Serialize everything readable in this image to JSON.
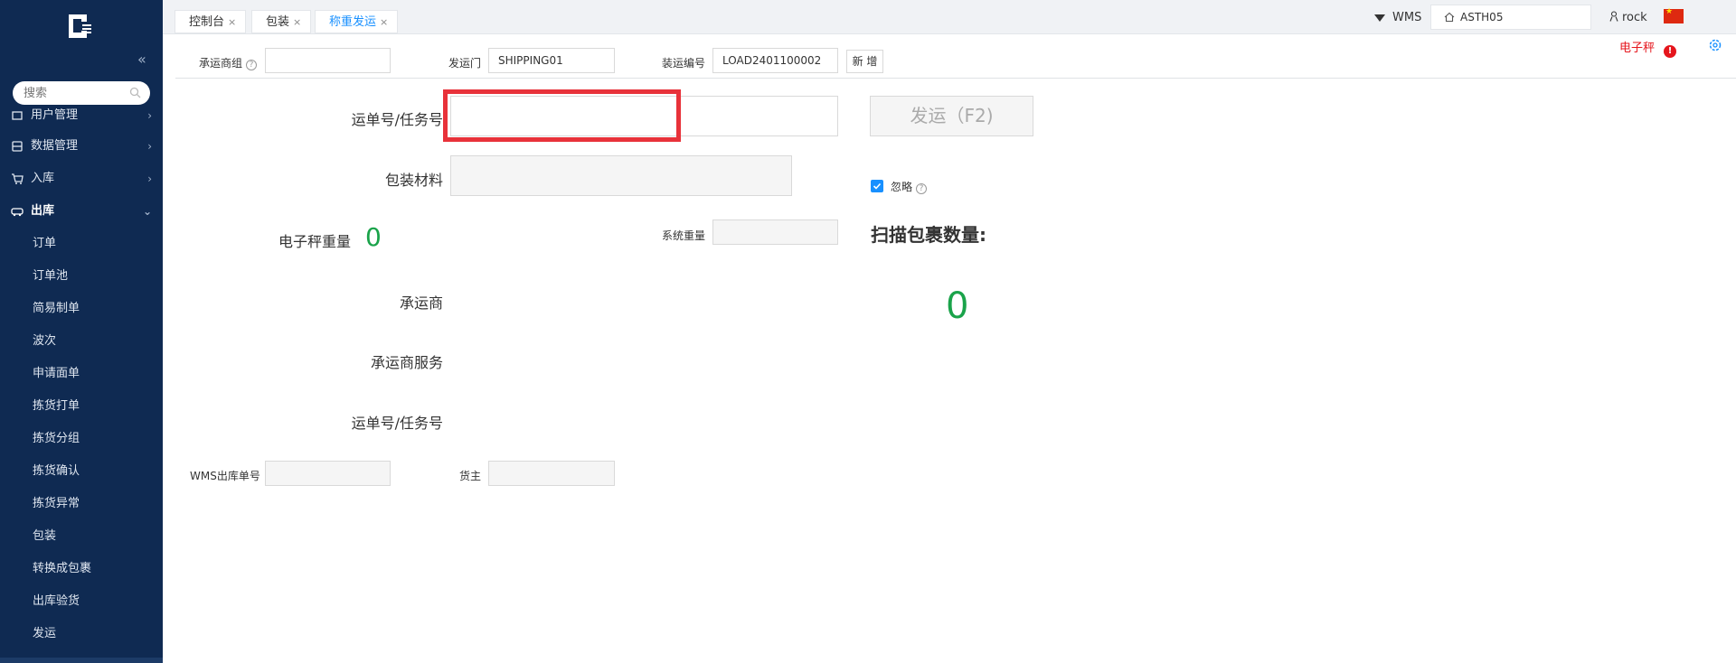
{
  "sidebar": {
    "search_placeholder": "搜索",
    "menu": [
      {
        "label": "用户管理",
        "icon": "user-icon"
      },
      {
        "label": "数据管理",
        "icon": "database-icon"
      },
      {
        "label": "入库",
        "icon": "cart-icon"
      },
      {
        "label": "出库",
        "icon": "truck-icon"
      }
    ],
    "submenu": [
      "订单",
      "订单池",
      "简易制单",
      "波次",
      "申请面单",
      "拣货打单",
      "拣货分组",
      "拣货确认",
      "拣货异常",
      "包装",
      "转换成包裹",
      "出库验货",
      "发运"
    ]
  },
  "tabs": [
    {
      "label": "控制台",
      "close": "×"
    },
    {
      "label": "包装",
      "close": "×"
    },
    {
      "label": "称重发运",
      "close": "×"
    }
  ],
  "header": {
    "system": "WMS",
    "warehouse": "ASTH05",
    "user": "rock",
    "scale_label": "电子秤",
    "scale_error": "!"
  },
  "filters": {
    "carrier_group_label": "承运商组",
    "carrier_group_value": "",
    "dock_label": "发运门",
    "dock_value": "SHIPPING01",
    "load_label": "装运编号",
    "load_value": "LOAD2401100002",
    "add_button": "新 增"
  },
  "form": {
    "waybill_label": "运单号/任务号",
    "waybill_value": "",
    "ship_button": "发运（F2)",
    "packing_label": "包装材料",
    "ignore_label": "忽略",
    "scale_weight_label": "电子秤重量",
    "scale_weight_value": "0",
    "system_weight_label": "系统重量",
    "scan_count_label": "扫描包裹数量:",
    "scan_count_value": "0",
    "carrier_label": "承运商",
    "carrier_service_label": "承运商服务",
    "waybill2_label": "运单号/任务号",
    "wms_order_label": "WMS出库单号",
    "owner_label": "货主"
  }
}
